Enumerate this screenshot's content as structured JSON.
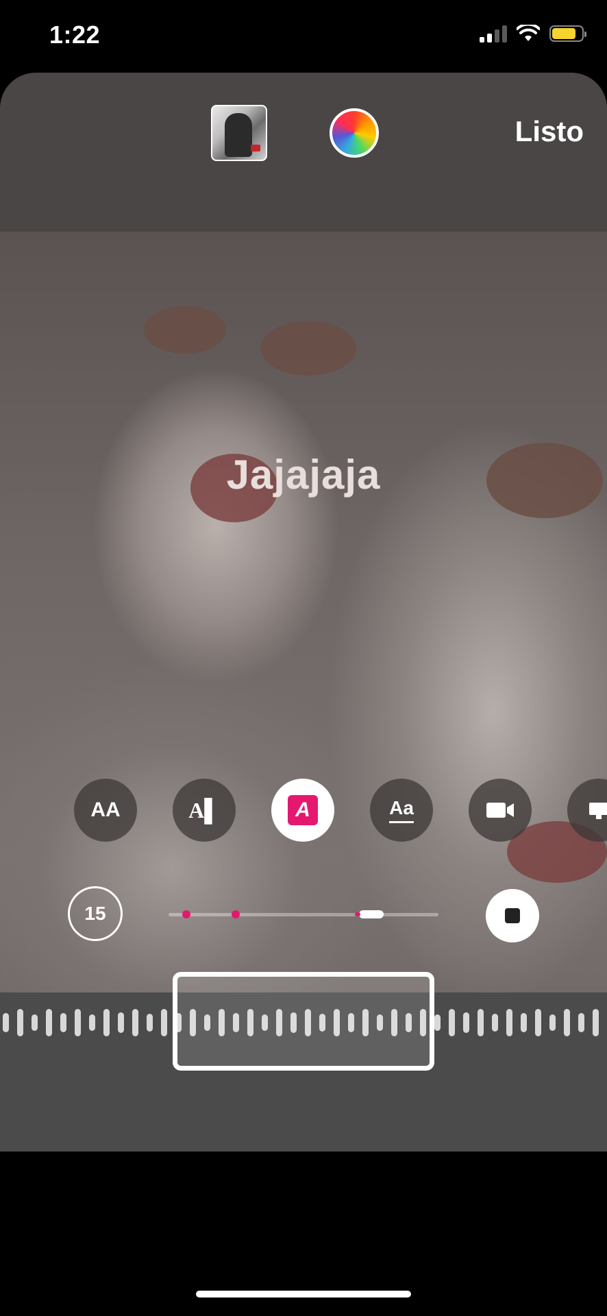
{
  "status_bar": {
    "time": "1:22"
  },
  "top_bar": {
    "done_label": "Listo",
    "icons": [
      "music-cover-icon",
      "color-wheel-icon"
    ]
  },
  "sticker": {
    "caption": "Jajajaja"
  },
  "text_styles": [
    {
      "name": "style-aa-icon",
      "label": "AA"
    },
    {
      "name": "style-typewriter-icon",
      "label": "A▌"
    },
    {
      "name": "style-highlight-icon",
      "label": "A",
      "selected": true
    },
    {
      "name": "style-underline-icon",
      "label": "Aa"
    },
    {
      "name": "style-camera-icon",
      "label": ""
    }
  ],
  "audio": {
    "clip_duration": "15",
    "accent_color": "#e5186f"
  }
}
